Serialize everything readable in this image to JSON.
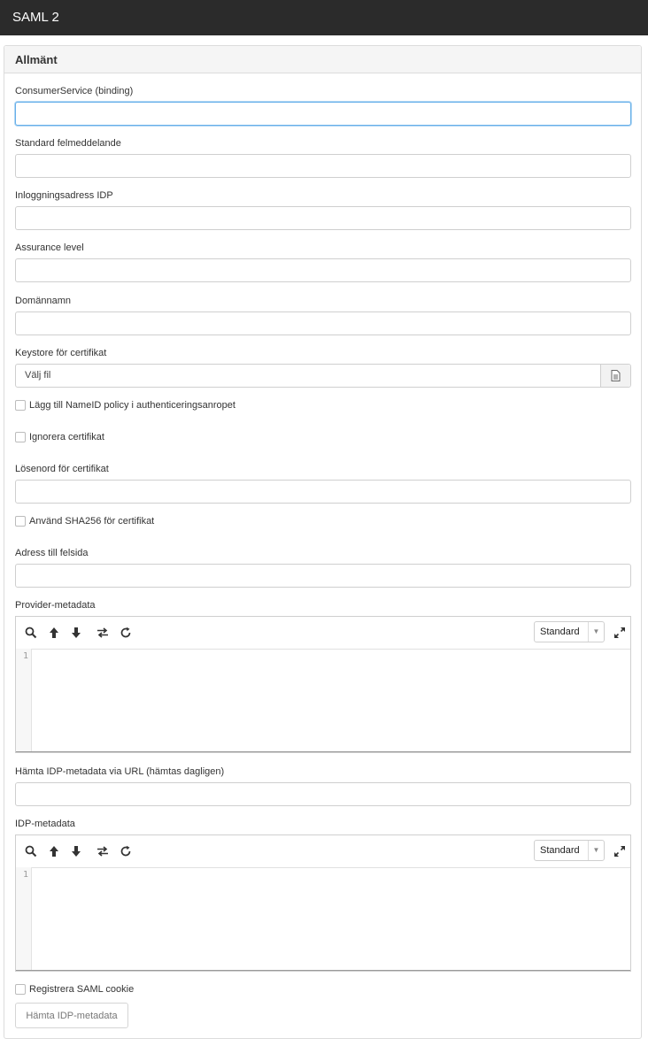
{
  "window": {
    "title": "SAML 2"
  },
  "panel": {
    "heading": "Allmänt"
  },
  "fields": {
    "consumer_service": {
      "label": "ConsumerService (binding)",
      "value": ""
    },
    "default_error": {
      "label": "Standard felmeddelande",
      "value": ""
    },
    "idp_login": {
      "label": "Inloggningsadress IDP",
      "value": ""
    },
    "assurance": {
      "label": "Assurance level",
      "value": ""
    },
    "domain": {
      "label": "Domännamn",
      "value": ""
    },
    "keystore": {
      "label": "Keystore för certifikat",
      "file_text": "Välj fil",
      "icon": "file-icon"
    },
    "cert_password": {
      "label": "Lösenord för certifikat",
      "value": ""
    },
    "error_page": {
      "label": "Adress till felsida",
      "value": ""
    },
    "idp_metadata_url": {
      "label": "Hämta IDP-metadata via URL (hämtas dagligen)",
      "value": ""
    }
  },
  "checkboxes": {
    "nameid": {
      "label": "Lägg till NameID policy i authenticeringsanropet",
      "checked": false
    },
    "ignore_cert": {
      "label": "Ignorera certifikat",
      "checked": false
    },
    "sha256": {
      "label": "Använd SHA256 för certifikat",
      "checked": false
    },
    "saml_cookie": {
      "label": "Registrera SAML cookie",
      "checked": false
    }
  },
  "editors": {
    "provider": {
      "label": "Provider-metadata",
      "mode": "Standard",
      "line": "1"
    },
    "idp": {
      "label": "IDP-metadata",
      "mode": "Standard",
      "line": "1"
    }
  },
  "editor_tools": [
    "search-icon",
    "arrow-up-icon",
    "arrow-down-icon",
    "swap-icon",
    "refresh-icon",
    "expand-icon"
  ],
  "actions": {
    "fetch_metadata": "Hämta IDP-metadata"
  },
  "colors": {
    "titlebar": "#2b2b2b",
    "focus": "#66afe9"
  }
}
